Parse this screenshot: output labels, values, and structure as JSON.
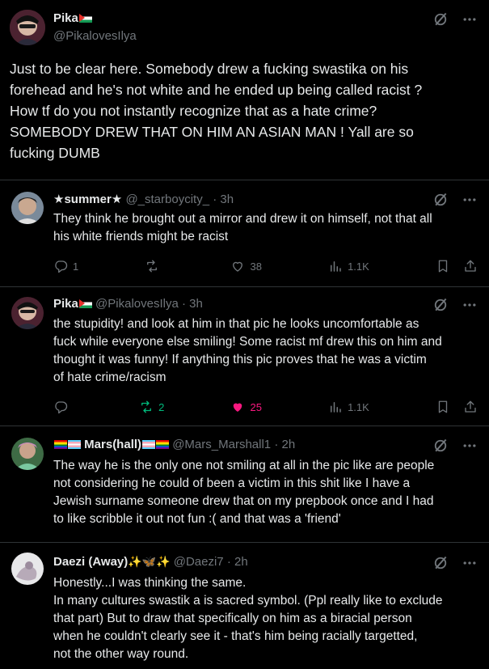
{
  "main_post": {
    "author_name": "Pika",
    "author_handle": "@PikalovesIlya",
    "text_lines": [
      "Just to be clear here. Somebody drew a fucking swastika on his",
      "forehead and he's not white and he ended up being called racist ?",
      "How tf do you not instantly recognize that as a hate crime?",
      "SOMEBODY DREW THAT ON HIM AN ASIAN MAN ! Yall are so",
      "fucking DUMB"
    ]
  },
  "replies": [
    {
      "author_name": "★summer★",
      "author_handle": "@_starboycity_",
      "time": "· 3h",
      "text_lines": [
        "They think he brought out a mirror and drew it on himself, not that all",
        "his white friends might be racist"
      ],
      "reply_count": "1",
      "repost_count": "",
      "like_count": "38",
      "view_count": "1.1K"
    },
    {
      "author_name": "Pika",
      "author_handle": "@PikalovesIlya",
      "time": "· 3h",
      "text_lines": [
        "the stupidity! and look at him in that pic he looks uncomfortable as",
        "fuck while everyone else smiling! Some racist mf drew this on him and",
        "thought it was funny! If anything this pic proves that he was a victim",
        "of hate crime/racism"
      ],
      "reply_count": "",
      "repost_count": "2",
      "like_count": "25",
      "view_count": "1.1K"
    },
    {
      "author_name": "Mars(hall)",
      "author_handle": "@Mars_Marshall1",
      "time": "· 2h",
      "text_lines": [
        "The way he is the only one not smiling at all in the pic like are people",
        "not considering he could of been a victim in this shit like I have a",
        "Jewish surname someone drew that on my prepbook once and I had",
        "to like scribble it out not fun :( and that was a 'friend'"
      ]
    },
    {
      "author_name": "Daezi (Away)",
      "author_emoji": "✨🦋✨",
      "author_handle": "@Daezi7",
      "time": "· 2h",
      "text_lines": [
        "Honestly...I was thinking the same.",
        "In many cultures swastik a is sacred symbol. (Ppl really like to exclude",
        "that part) But to draw that specifically on him as a biracial person",
        "when he couldn't clearly see it - that's him being racially targetted,",
        "not the other way round."
      ]
    }
  ],
  "colors": {
    "background": "#000000",
    "text": "#e7e9ea",
    "muted": "#71767b",
    "divider": "#2f3336",
    "repost_active": "#00ba7c",
    "like_active": "#f91880"
  },
  "icons": [
    "grok-icon",
    "more-icon",
    "reply-icon",
    "repost-icon",
    "like-icon",
    "views-icon",
    "bookmark-icon",
    "share-icon"
  ]
}
